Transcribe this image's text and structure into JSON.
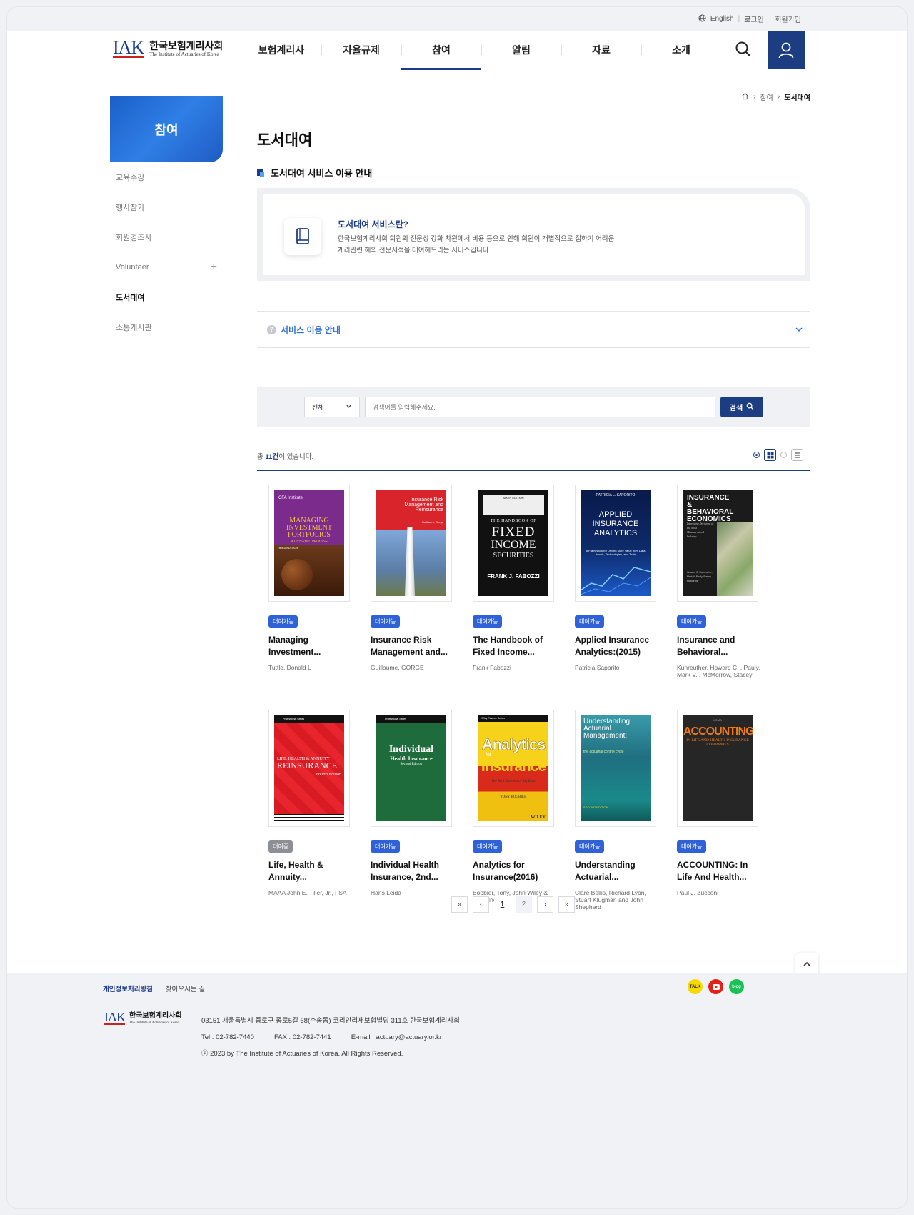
{
  "utility": {
    "lang": "English",
    "login": "로그인",
    "join": "회원가입"
  },
  "logo": {
    "mark": "IAK",
    "ko": "한국보험계리사회",
    "en": "The Institute of Actuaries of Korea"
  },
  "nav": [
    "보험계리사",
    "자율규제",
    "참여",
    "알림",
    "자료",
    "소개"
  ],
  "nav_active": "참여",
  "sidebar": {
    "title": "참여",
    "items": [
      {
        "label": "교육수강"
      },
      {
        "label": "행사참가"
      },
      {
        "label": "회원경조사"
      },
      {
        "label": "Volunteer",
        "expandable": true
      },
      {
        "label": "도서대여",
        "active": true
      },
      {
        "label": "소통게시판"
      }
    ]
  },
  "breadcrumb": {
    "level1": "참여",
    "current": "도서대여"
  },
  "page_title": "도서대여",
  "section_title": "도서대여 서비스 이용 안내",
  "info": {
    "heading": "도서대여 서비스란?",
    "line1": "한국보험계리사회 회원의 전문성 강화 차원에서 비용 등으로 인해 회원이 개별적으로 접하기 어려운",
    "line2": "계리관련 해외 전문서적을 대여해드리는 서비스입니다."
  },
  "accordion": {
    "label": "서비스 이용 안내"
  },
  "search": {
    "select_value": "전체",
    "placeholder": "검색어를 입력해주세요.",
    "button": "검색"
  },
  "results": {
    "prefix": "총 ",
    "count": "11건",
    "suffix": "이 있습니다."
  },
  "books": [
    {
      "badge": "대여가능",
      "available": true,
      "title1": "Managing",
      "title2": "Investment...",
      "author": "Tuttle, Donald L"
    },
    {
      "badge": "대여가능",
      "available": true,
      "title1": "Insurance Risk",
      "title2": "Management and...",
      "author": "Guillaume, GORGE"
    },
    {
      "badge": "대여가능",
      "available": true,
      "title1": "The Handbook of",
      "title2": "Fixed Income...",
      "author": "Frank Fabozzi"
    },
    {
      "badge": "대여가능",
      "available": true,
      "title1": "Applied Insurance",
      "title2": "Analytics:(2015)",
      "author": "Patricia Saporito"
    },
    {
      "badge": "대여가능",
      "available": true,
      "title1": "Insurance and",
      "title2": "Behavioral...",
      "author": "Kunreuther, Howard C. , Pauly, Mark V. , McMorrow, Stacey"
    },
    {
      "badge": "대여중",
      "available": false,
      "title1": "Life, Health &",
      "title2": "Annuity...",
      "author": "MAAA John E. Tiller, Jr., FSA"
    },
    {
      "badge": "대여가능",
      "available": true,
      "title1": "Individual Health",
      "title2": "Insurance, 2nd...",
      "author": "Hans Leida"
    },
    {
      "badge": "대여가능",
      "available": true,
      "title1": "Analytics for",
      "title2": "Insurance(2016)",
      "author": "Boobier, Tony, John Wiley & Sons Inc |"
    },
    {
      "badge": "대여가능",
      "available": true,
      "title1": "Understanding",
      "title2": "Actuarial...",
      "author": "Clare Bellis, Richard Lyon, Stuart Klugman and John Shepherd"
    },
    {
      "badge": "대여가능",
      "available": true,
      "title1": "ACCOUNTING: In",
      "title2": "Life And Health...",
      "author": "Paul J. Zucconi"
    }
  ],
  "covers": [
    {
      "top": "CFA Institute",
      "main": "MANAGING INVESTMENT PORTFOLIOS",
      "sub": "A DYNAMIC PROCESS",
      "edition": "THIRD EDITION"
    },
    {
      "main": "Insurance Risk Management and Reinsurance",
      "sub": "Guillaume Gorge"
    },
    {
      "top": "SIXTH EDITION",
      "main1": "THE HANDBOOK OF",
      "main2": "FIXED",
      "main3": "INCOME",
      "main4": "SECURITIES",
      "author": "FRANK J. FABOZZI"
    },
    {
      "top": "PATRICIA L. SAPORITO",
      "main": "APPLIED INSURANCE ANALYTICS",
      "sub": "A Framework for Driving More Value from Data Assets, Technologies, and Tools"
    },
    {
      "main": "INSURANCE & BEHAVIORAL ECONOMICS",
      "sub": "Improving Decisions in the Most Misunderstood Industry",
      "authors": "Howard C. Kunreuther, Mark V. Pauly, Stacey McMorrow"
    },
    {
      "top": "Professional Series",
      "main1": "LIFE, HEALTH & ANNUITY",
      "main2": "REINSURANCE",
      "sub": "Fourth Edition"
    },
    {
      "top": "Professional Series",
      "main1": "Individual",
      "main2": "Health Insurance",
      "sub": "Second Edition"
    },
    {
      "top": "Wiley Finance Series",
      "main1": "Analytics",
      "main2": "for",
      "main3": "Insurance",
      "sub": "The Real Business of Big Data",
      "author": "TONY BOOBIER",
      "pub": "WILEY"
    },
    {
      "main": "Understanding Actuarial Management:",
      "sub": "the actuarial control cycle",
      "edition": "SECOND EDITION"
    },
    {
      "top": "LOMA",
      "main": "ACCOUNTING",
      "sub": "IN LIFE AND HEALTH INSURANCE COMPANIES"
    }
  ],
  "pagination": {
    "first": "«",
    "prev": "‹",
    "pages": [
      "1",
      "2"
    ],
    "next": "›",
    "last": "»"
  },
  "footer": {
    "privacy": "개인정보처리방침",
    "directions": "찾아오시는 길",
    "address": "03151 서울특별시 종로구 종로5길 68(수송동) 코리안리재보험빌딩 311호 한국보험계리사회",
    "tel": "Tel : 02-782-7440",
    "fax": "FAX : 02-782-7441",
    "email": "E-mail : actuary@actuary.or.kr",
    "copyright": "ⓒ 2023 by The Institute of Actuaries of Korea. All Rights Reserved.",
    "sns": {
      "kakao": "TALK",
      "blog": "blog"
    }
  },
  "colors": {
    "brand": "#1d3d83",
    "accent": "#2f62d8",
    "kakao": "#f7d900",
    "youtube": "#e62117",
    "blog": "#19c157"
  }
}
